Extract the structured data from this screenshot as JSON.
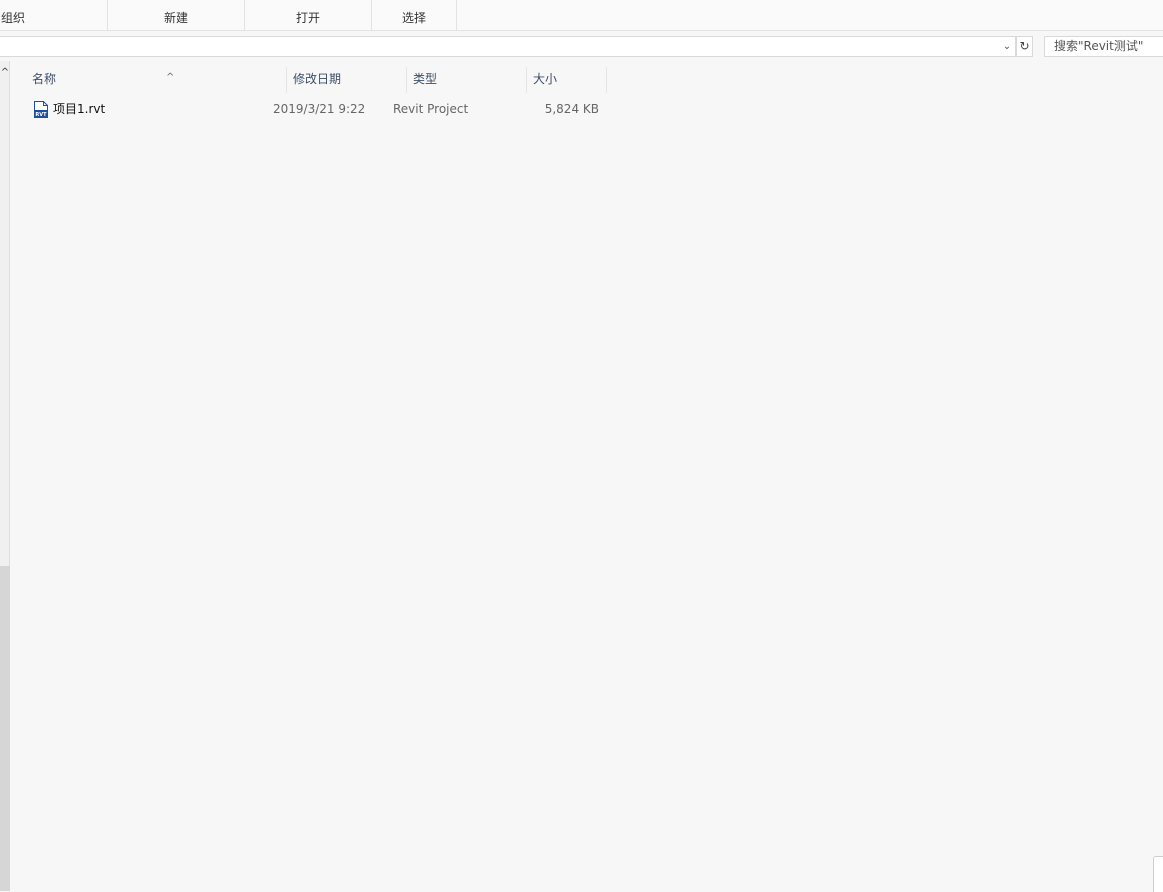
{
  "ribbon": {
    "groups": [
      {
        "label": "组织"
      },
      {
        "label": "新建"
      },
      {
        "label": "打开"
      },
      {
        "label": "选择"
      }
    ]
  },
  "address": {
    "value": "",
    "dropdown_icon": "chevron-down-icon",
    "refresh_icon": "refresh-icon",
    "refresh_glyph": "↻",
    "dropdown_glyph": "⌄"
  },
  "search": {
    "placeholder": "搜索\"Revit测试\""
  },
  "nav": {
    "up_glyph": "^"
  },
  "columns": {
    "name": "名称",
    "modified": "修改日期",
    "type": "类型",
    "size": "大小",
    "sort_glyph": "^"
  },
  "files": [
    {
      "name": "项目1.rvt",
      "modified": "2019/3/21 9:22",
      "type": "Revit Project",
      "size": "5,824 KB",
      "icon": "rvt-file-icon",
      "icon_label": "RVT"
    }
  ],
  "colors": {
    "header_text": "#3c4f66",
    "icon_blue": "#1f4e9c"
  }
}
